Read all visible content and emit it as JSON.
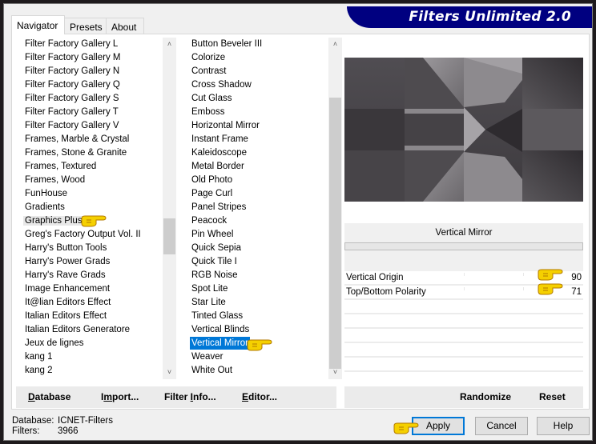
{
  "window": {
    "title": "Filters Unlimited 2.0"
  },
  "tabs": [
    {
      "label": "Navigator",
      "active": true
    },
    {
      "label": "Presets",
      "active": false
    },
    {
      "label": "About",
      "active": false
    }
  ],
  "category_list": {
    "items": [
      "Filter Factory Gallery L",
      "Filter Factory Gallery M",
      "Filter Factory Gallery N",
      "Filter Factory Gallery Q",
      "Filter Factory Gallery S",
      "Filter Factory Gallery T",
      "Filter Factory Gallery V",
      "Frames, Marble & Crystal",
      "Frames, Stone & Granite",
      "Frames, Textured",
      "Frames, Wood",
      "FunHouse",
      "Gradients",
      "Graphics Plus",
      "Greg's Factory Output Vol. II",
      "Harry's Button Tools",
      "Harry's Power Grads",
      "Harry's Rave Grads",
      "Image Enhancement",
      "It@lian Editors Effect",
      "Italian Editors Effect",
      "Italian Editors Generatore",
      "Jeux de lignes",
      "kang 1",
      "kang 2"
    ],
    "selected": "Graphics Plus"
  },
  "filter_list": {
    "items": [
      "Button Beveler III",
      "Colorize",
      "Contrast",
      "Cross Shadow",
      "Cut Glass",
      "Emboss",
      "Horizontal Mirror",
      "Instant Frame",
      "Kaleidoscope",
      "Metal Border",
      "Old Photo",
      "Page Curl",
      "Panel Stripes",
      "Peacock",
      "Pin Wheel",
      "Quick Sepia",
      "Quick Tile I",
      "RGB Noise",
      "Spot Lite",
      "Star Lite",
      "Tinted Glass",
      "Vertical Blinds",
      "Vertical Mirror",
      "Weaver",
      "White Out"
    ],
    "selected": "Vertical Mirror"
  },
  "scroll_icons": {
    "up": "▲",
    "down": "▼"
  },
  "parameters": {
    "filter_title": "Vertical Mirror",
    "items": [
      {
        "label": "Vertical Origin",
        "value": "90"
      },
      {
        "label": "Top/Bottom Polarity",
        "value": "71"
      }
    ]
  },
  "param_buttons": {
    "randomize": "Randomize",
    "reset": "Reset"
  },
  "db_buttons": {
    "database": {
      "pre": "",
      "u": "D",
      "post": "atabase"
    },
    "import": {
      "pre": "I",
      "u": "m",
      "post": "port..."
    },
    "filter_info": {
      "pre": "Filter ",
      "u": "I",
      "post": "nfo..."
    },
    "editor": {
      "pre": "",
      "u": "E",
      "post": "ditor..."
    }
  },
  "status": {
    "database_label": "Database:",
    "database_value": "ICNET-Filters",
    "filters_label": "Filters:",
    "filters_value": "3966"
  },
  "buttons": {
    "apply": "Apply",
    "cancel": "Cancel",
    "help": "Help"
  },
  "colors": {
    "banner": "#000080",
    "selection": "#0078d7",
    "hand": "#f5d000"
  }
}
